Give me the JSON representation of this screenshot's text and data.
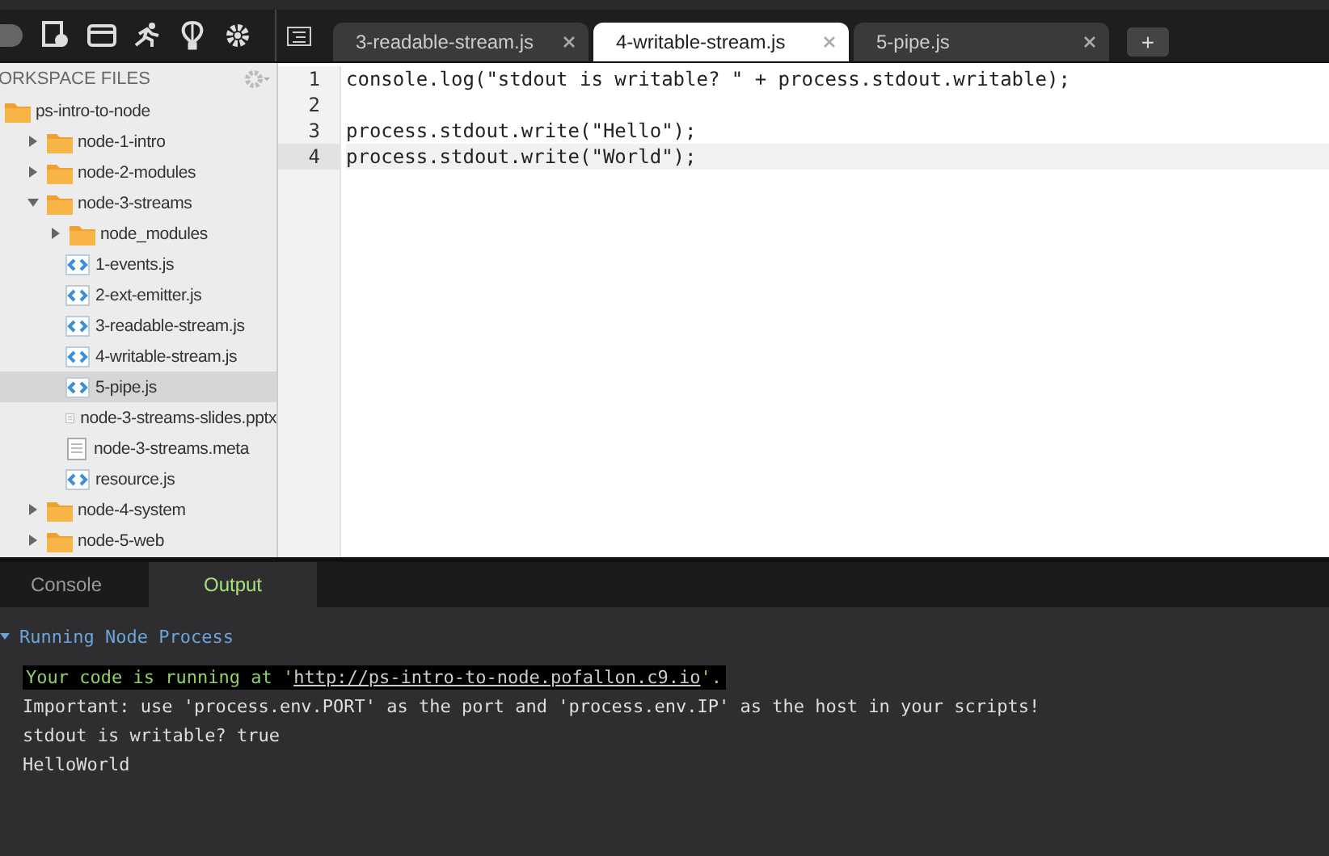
{
  "toolbar": {
    "tabs": [
      {
        "label": "3-readable-stream.js",
        "selected": false
      },
      {
        "label": "4-writable-stream.js",
        "selected": true
      },
      {
        "label": "5-pipe.js",
        "selected": false
      }
    ],
    "new_tab": "+"
  },
  "sidebar": {
    "title": "ORKSPACE FILES",
    "tree": [
      {
        "label": "ps-intro-to-node",
        "kind": "folder",
        "selected": false,
        "children": [
          {
            "label": "node-1-intro",
            "kind": "folder",
            "expanded": false,
            "selected": false
          },
          {
            "label": "node-2-modules",
            "kind": "folder",
            "expanded": false,
            "selected": false
          },
          {
            "label": "node-3-streams",
            "kind": "folder",
            "expanded": true,
            "selected": false,
            "children": [
              {
                "label": "node_modules",
                "kind": "folder",
                "expanded": false,
                "selected": false
              },
              {
                "label": "1-events.js",
                "kind": "js",
                "selected": false
              },
              {
                "label": "2-ext-emitter.js",
                "kind": "js",
                "selected": false
              },
              {
                "label": "3-readable-stream.js",
                "kind": "js",
                "selected": false
              },
              {
                "label": "4-writable-stream.js",
                "kind": "js",
                "selected": false
              },
              {
                "label": "5-pipe.js",
                "kind": "js",
                "selected": true
              },
              {
                "label": "node-3-streams-slides.pptx",
                "kind": "file",
                "selected": false
              },
              {
                "label": "node-3-streams.meta",
                "kind": "file",
                "selected": false
              },
              {
                "label": "resource.js",
                "kind": "js",
                "selected": false
              }
            ]
          },
          {
            "label": "node-4-system",
            "kind": "folder",
            "expanded": false,
            "selected": false
          },
          {
            "label": "node-5-web",
            "kind": "folder",
            "expanded": false,
            "selected": false
          }
        ]
      }
    ]
  },
  "editor": {
    "lines": [
      {
        "number": "1",
        "code": "console.log(\"stdout is writable? \" + process.stdout.writable);",
        "current": false
      },
      {
        "number": "2",
        "current": false
      },
      {
        "number": "3",
        "code": "process.stdout.write(\"Hello\");",
        "current": false
      },
      {
        "number": "4",
        "code": "process.stdout.write(\"World\");",
        "current": true
      }
    ]
  },
  "panel": {
    "tabs": [
      {
        "label": "Console",
        "selected": false
      },
      {
        "label": "Output",
        "selected": true
      }
    ],
    "section": "Running Node Process",
    "output": [
      {
        "kind": "notice",
        "text": "Your code is running at '",
        "link": "http://ps-intro-to-node.pofallon.c9.io",
        "after": "'."
      },
      {
        "kind": "plain",
        "text": "Important: use 'process.env.PORT' as the port and 'process.env.IP' as the host in your scripts!"
      },
      {
        "kind": "plain",
        "text": "stdout is writable? true"
      },
      {
        "kind": "plain",
        "text": "HelloWorld"
      }
    ]
  }
}
